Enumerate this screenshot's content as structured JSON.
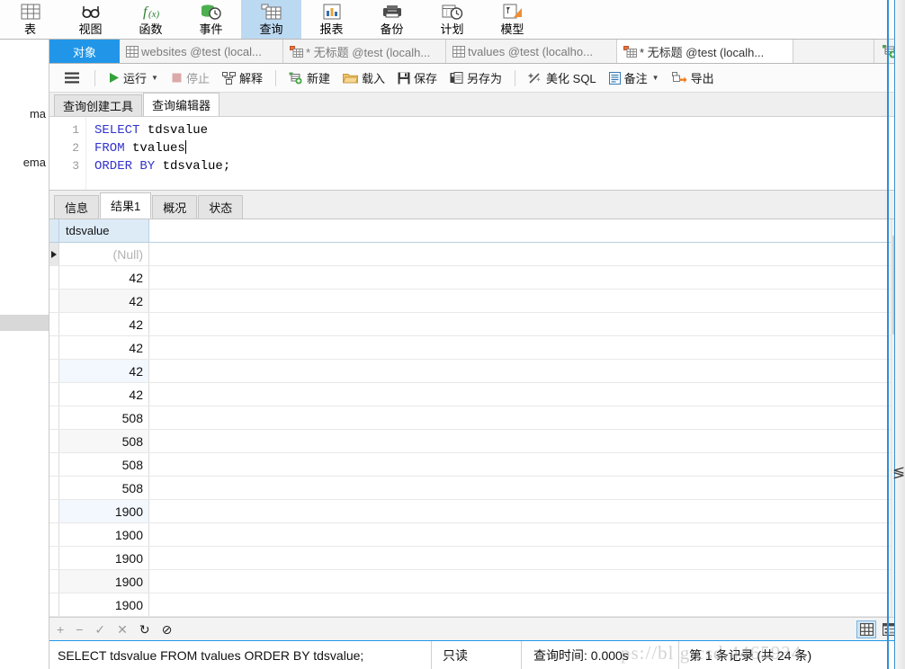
{
  "app": {
    "accent_color": "#2196e8",
    "active_ribbon_bg": "#bcd9f2"
  },
  "ribbon": {
    "items": [
      {
        "label": "表",
        "icon": "table-icon"
      },
      {
        "label": "视图",
        "icon": "view-glasses-icon"
      },
      {
        "label": "函数",
        "icon": "function-fx-icon"
      },
      {
        "label": "事件",
        "icon": "event-clock-icon"
      },
      {
        "label": "查询",
        "icon": "query-icon",
        "active": true
      },
      {
        "label": "报表",
        "icon": "report-chart-icon"
      },
      {
        "label": "备份",
        "icon": "backup-icon"
      },
      {
        "label": "计划",
        "icon": "schedule-clock-icon"
      },
      {
        "label": "模型",
        "icon": "model-icon"
      }
    ]
  },
  "tabbar": {
    "object_tab": "对象",
    "tabs": [
      {
        "label": "websites @test (local...",
        "icon": "table-tab-icon",
        "active": false,
        "modified": false
      },
      {
        "label": "* 无标题 @test (localh...",
        "icon": "query-tab-icon",
        "active": false,
        "modified": true
      },
      {
        "label": "tvalues @test (localho...",
        "icon": "table-tab-icon",
        "active": false,
        "modified": false
      },
      {
        "label": "* 无标题 @test (localh...",
        "icon": "query-tab-icon",
        "active": true,
        "modified": true
      }
    ],
    "new_tab_icon": "new-query-icon"
  },
  "toolbar": {
    "menu_icon": "hamburger-menu-icon",
    "buttons": [
      {
        "label": "运行",
        "icon": "run-play-icon",
        "has_caret": true,
        "disabled": false
      },
      {
        "label": "停止",
        "icon": "stop-square-icon",
        "has_caret": false,
        "disabled": true
      },
      {
        "label": "解释",
        "icon": "explain-icon",
        "has_caret": false,
        "disabled": false
      },
      {
        "label": "新建",
        "icon": "new-doc-icon",
        "has_caret": false,
        "disabled": false
      },
      {
        "label": "载入",
        "icon": "open-folder-icon",
        "has_caret": false,
        "disabled": false
      },
      {
        "label": "保存",
        "icon": "save-disk-icon",
        "has_caret": false,
        "disabled": false
      },
      {
        "label": "另存为",
        "icon": "save-as-icon",
        "has_caret": false,
        "disabled": false
      },
      {
        "label": "美化 SQL",
        "icon": "beautify-wand-icon",
        "has_caret": false,
        "disabled": false
      },
      {
        "label": "备注",
        "icon": "note-icon",
        "has_caret": true,
        "disabled": false
      },
      {
        "label": "导出",
        "icon": "export-arrow-icon",
        "has_caret": false,
        "disabled": false
      }
    ]
  },
  "editor_tabs": [
    {
      "label": "查询创建工具",
      "active": false
    },
    {
      "label": "查询编辑器",
      "active": true
    }
  ],
  "editor": {
    "lines": [
      {
        "num": "1",
        "tokens": [
          {
            "t": "SELECT",
            "c": "kw"
          },
          {
            "t": " tdsvalue",
            "c": "idn"
          }
        ]
      },
      {
        "num": "2",
        "tokens": [
          {
            "t": "FROM",
            "c": "kw"
          },
          {
            "t": " tvalues",
            "c": "idn"
          }
        ],
        "caret_at_end": true
      },
      {
        "num": "3",
        "tokens": [
          {
            "t": "ORDER BY",
            "c": "kw"
          },
          {
            "t": " tdsvalue;",
            "c": "idn"
          }
        ]
      }
    ]
  },
  "result_tabs": [
    {
      "label": "信息",
      "active": false
    },
    {
      "label": "结果1",
      "active": true
    },
    {
      "label": "概况",
      "active": false
    },
    {
      "label": "状态",
      "active": false
    }
  ],
  "grid": {
    "columns": [
      "tdsvalue"
    ],
    "rows": [
      {
        "value": "(Null)",
        "is_null": true,
        "current": true
      },
      {
        "value": "42"
      },
      {
        "value": "42"
      },
      {
        "value": "42"
      },
      {
        "value": "42"
      },
      {
        "value": "42",
        "highlight": true
      },
      {
        "value": "42"
      },
      {
        "value": "508"
      },
      {
        "value": "508"
      },
      {
        "value": "508"
      },
      {
        "value": "508"
      },
      {
        "value": "1900",
        "highlight": true
      },
      {
        "value": "1900"
      },
      {
        "value": "1900"
      },
      {
        "value": "1900"
      },
      {
        "value": "1900"
      }
    ],
    "footer_icons": [
      {
        "icon": "add-row-icon",
        "glyph": "+",
        "enabled": false
      },
      {
        "icon": "delete-row-icon",
        "glyph": "−",
        "enabled": false
      },
      {
        "icon": "apply-check-icon",
        "glyph": "✓",
        "enabled": false
      },
      {
        "icon": "cancel-cross-icon",
        "glyph": "✕",
        "enabled": false
      },
      {
        "icon": "refresh-icon",
        "glyph": "↻",
        "enabled": true
      },
      {
        "icon": "stop-ban-icon",
        "glyph": "⊘",
        "enabled": true
      }
    ],
    "view_buttons": [
      {
        "icon": "grid-view-icon",
        "selected": true
      },
      {
        "icon": "form-view-icon",
        "selected": false
      }
    ]
  },
  "statusbar": {
    "sql": "SELECT tdsvalue FROM tvalues ORDER BY tdsvalue;",
    "readonly": "只读",
    "query_time": "查询时间: 0.000s",
    "record_info": "第 1 条记录 (共 24 条)"
  },
  "sidebar_cut": {
    "line1": "ma",
    "line2": "ema"
  },
  "watermark": {
    "text": "ps://bl g.csd  4465934"
  }
}
